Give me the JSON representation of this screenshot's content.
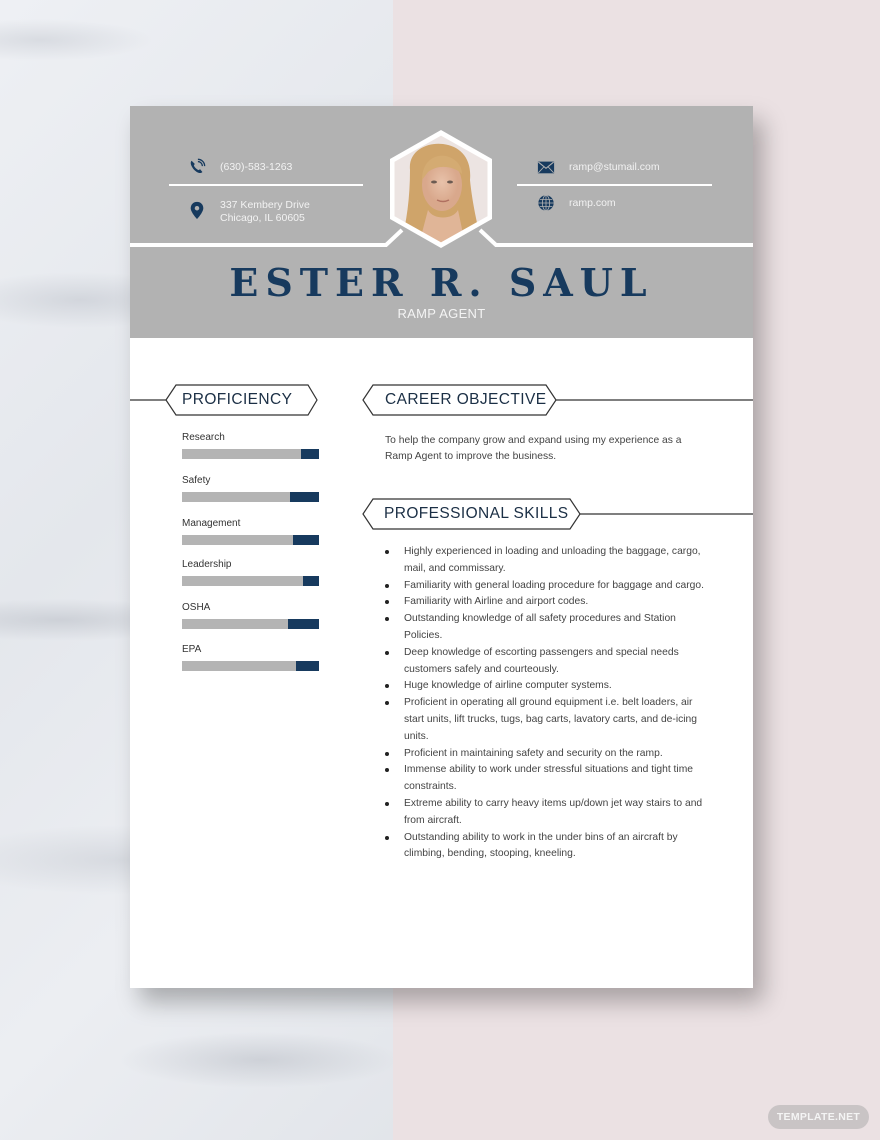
{
  "resume": {
    "name": "ESTER R. SAUL",
    "job_title": "RAMP AGENT",
    "contact": {
      "phone": "(630)-583-1263",
      "address_line1": "337 Kembery Drive",
      "address_line2": "Chicago, IL 60605",
      "email": "ramp@stumail.com",
      "website": "ramp.com"
    },
    "icons": {
      "phone": "phone-icon",
      "address": "location-pin-icon",
      "email": "envelope-icon",
      "website": "globe-icon"
    },
    "colors": {
      "accent": "#173a5e",
      "header_bg": "#b2b2b2",
      "bar_bg": "#b4b4b4"
    },
    "proficiency": {
      "heading": "PROFICIENCY",
      "items": [
        {
          "label": "Research",
          "level": 0.87
        },
        {
          "label": "Safety",
          "level": 0.79
        },
        {
          "label": "Management",
          "level": 0.81
        },
        {
          "label": "Leadership",
          "level": 0.88
        },
        {
          "label": "OSHA",
          "level": 0.77
        },
        {
          "label": "EPA",
          "level": 0.83
        }
      ]
    },
    "career_objective": {
      "heading": "CAREER OBJECTIVE",
      "text": "To help the company grow and expand using my experience as a Ramp Agent to improve the business."
    },
    "professional_skills": {
      "heading": "PROFESSIONAL SKILLS",
      "items": [
        "Highly experienced in loading and unloading the baggage, cargo, mail, and commissary.",
        "Familiarity with general loading procedure for baggage and cargo.",
        "Familiarity with Airline and airport codes.",
        "Outstanding knowledge of all safety procedures and Station Policies.",
        "Deep knowledge of escorting passengers and special needs customers safely and courteously.",
        "Huge knowledge of airline computer systems.",
        "Proficient in operating all ground equipment i.e. belt loaders, air start units, lift trucks, tugs, bag carts, lavatory carts, and de-icing units.",
        "Proficient in maintaining safety and security on the ramp.",
        "Immense ability to work under stressful situations and tight time constraints.",
        "Extreme ability to carry heavy items up/down jet way stairs to and from aircraft.",
        "Outstanding ability to work in the under bins of an aircraft by climbing, bending, stooping, kneeling."
      ]
    }
  },
  "watermark": "TEMPLATE.NET"
}
